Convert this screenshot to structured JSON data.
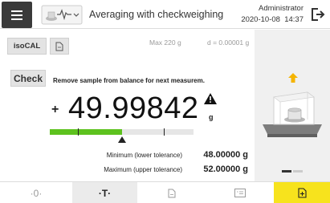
{
  "header": {
    "title": "Averaging with checkweighing",
    "user": "Administrator",
    "date": "2020-10-08",
    "time": "14:37"
  },
  "toolbar": {
    "iso_label": "isoCAL",
    "capacity": "Max 220 g",
    "readability": "d = 0.00001 g"
  },
  "status": {
    "check_label": "Check",
    "message": "Remove sample from balance for next measurem."
  },
  "weighing": {
    "sign": "+",
    "value": "49.99842",
    "unit": "g",
    "bar_fill_fraction": 0.5,
    "pointer_fraction": 0.5
  },
  "tolerance": {
    "min_label": "Minimum (lower tolerance)",
    "min_value": "48.00000 g",
    "max_label": "Maximum (upper tolerance)",
    "max_value": "52.00000 g"
  },
  "bottom_bar": {
    "zero_label": "·0·",
    "tare_label": "·T·"
  },
  "colors": {
    "accent_yellow": "#f7e31d",
    "in_tolerance_green": "#5dc21e",
    "menu_dark": "#3a3a3a"
  },
  "icons": {
    "menu": "hamburger-icon",
    "app": "balance-app-icon",
    "logout": "logout-icon",
    "protocol": "document-icon",
    "warning": "warning-triangle-icon",
    "arrow": "arrow-up-icon",
    "print": "print-icon",
    "save": "save-export-icon"
  }
}
